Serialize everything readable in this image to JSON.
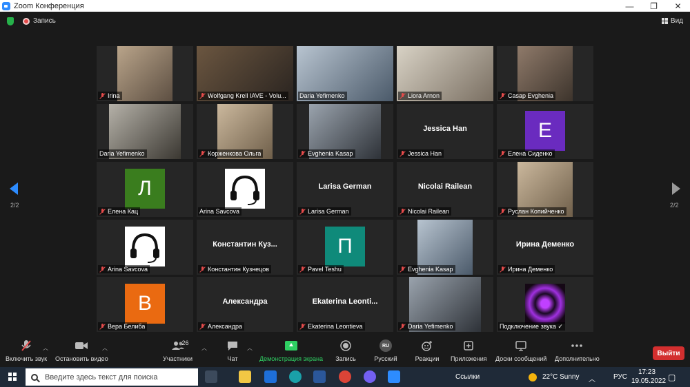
{
  "window": {
    "title": "Zoom Конференция",
    "minimize": "—",
    "maximize": "❐",
    "close": "✕"
  },
  "topbar": {
    "recording_label": "Запись",
    "view_label": "Вид"
  },
  "gallery": {
    "page_left": "2/2",
    "page_right": "2/2",
    "tiles": [
      {
        "name": "Irina",
        "type": "video",
        "muted": true
      },
      {
        "name": "Wolfgang Krell IAVE - Volu...",
        "type": "video",
        "muted": true
      },
      {
        "name": "Daria Yefimenko",
        "type": "video",
        "muted": false,
        "active": true
      },
      {
        "name": "Liora Arnon",
        "type": "video",
        "muted": true
      },
      {
        "name": "Casap Evghenia",
        "type": "video",
        "muted": true
      },
      {
        "name": "Daria Yefimenko",
        "type": "video",
        "muted": false
      },
      {
        "name": "Корженкова Ольга",
        "type": "video",
        "muted": true
      },
      {
        "name": "Evghenia Kasap",
        "type": "video",
        "muted": true
      },
      {
        "name": "Jessica Han",
        "type": "text",
        "big": "Jessica Han",
        "muted": true
      },
      {
        "name": "Елена Сиденко",
        "type": "letter",
        "letter": "Е",
        "color": "#6a2bbf",
        "muted": true
      },
      {
        "name": "Елена Кац",
        "type": "letter",
        "letter": "Л",
        "color": "#3a7d1e",
        "muted": true
      },
      {
        "name": "Arina Savcova",
        "type": "headphones",
        "muted": false
      },
      {
        "name": "Larisa German",
        "type": "text",
        "big": "Larisa German",
        "muted": true
      },
      {
        "name": "Nicolai Railean",
        "type": "text",
        "big": "Nicolai Railean",
        "muted": true
      },
      {
        "name": "Руслан Копийченко",
        "type": "video",
        "muted": true
      },
      {
        "name": "Arina Savcova",
        "type": "headphones",
        "muted": true
      },
      {
        "name": "Константин Кузнецов",
        "type": "text",
        "big": "Константин  Куз...",
        "muted": true
      },
      {
        "name": "Pavel Teshu",
        "type": "letter",
        "letter": "П",
        "color": "#0f8a7a",
        "muted": true
      },
      {
        "name": "Evghenia Kasap",
        "type": "video",
        "muted": true
      },
      {
        "name": "Ирина Деменко",
        "type": "text",
        "big": "Ирина Деменко",
        "muted": true
      },
      {
        "name": "Вера Белиба",
        "type": "letter",
        "letter": "В",
        "color": "#ea6a11",
        "muted": true
      },
      {
        "name": "Александра",
        "type": "text",
        "big": "Александра",
        "muted": true
      },
      {
        "name": "Ekaterina Leontieva",
        "type": "text",
        "big": "Ekaterina  Leonti...",
        "muted": true
      },
      {
        "name": "Daria Yefimenko",
        "type": "video",
        "muted": true
      },
      {
        "name": "Подключение звука ✓",
        "type": "video",
        "muted": false
      }
    ]
  },
  "toolbar": {
    "unmute": "Включить звук",
    "start_video": "Остановить видео",
    "participants": "Участники",
    "participants_count": "26",
    "chat": "Чат",
    "share": "Демонстрация экрана",
    "record": "Запись",
    "language_badge": "RU",
    "language": "Русский",
    "reactions": "Реакции",
    "apps": "Приложения",
    "whiteboards": "Доски сообщений",
    "more": "Дополнительно",
    "leave": "Выйти"
  },
  "taskbar": {
    "search_placeholder": "Введите здесь текст для поиска",
    "links": "Ссылки",
    "weather": "22°C  Sunny",
    "lang": "РУС",
    "time": "17:23",
    "date": "19.05.2022"
  }
}
